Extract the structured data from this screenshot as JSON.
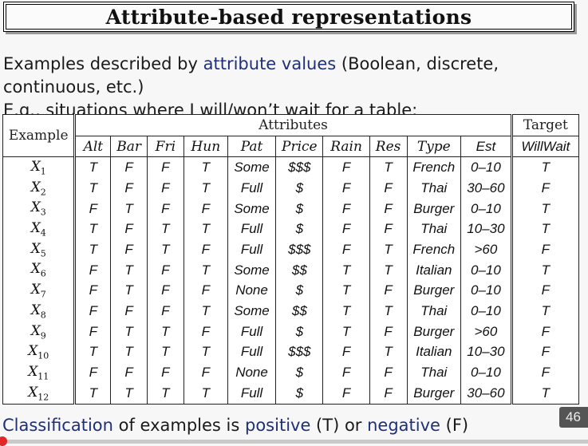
{
  "title": "Attribute-based representations",
  "intro": {
    "line1_a": "Examples described by ",
    "line1_link": "attribute values",
    "line1_b": " (Boolean, discrete, continuous, etc.)",
    "line2": "E.g., situations where I will/won’t wait for a table:"
  },
  "table": {
    "example_header": "Example",
    "attributes_header": "Attributes",
    "target_header": "Target",
    "attribute_names": [
      "Alt",
      "Bar",
      "Fri",
      "Hun",
      "Pat",
      "Price",
      "Rain",
      "Res",
      "Type",
      "Est"
    ],
    "target_name": "WillWait",
    "rows": [
      {
        "id": "X",
        "sub": "1",
        "values": [
          "T",
          "F",
          "F",
          "T",
          "Some",
          "$$$",
          "F",
          "T",
          "French",
          "0–10"
        ],
        "target": "T"
      },
      {
        "id": "X",
        "sub": "2",
        "values": [
          "T",
          "F",
          "F",
          "T",
          "Full",
          "$",
          "F",
          "F",
          "Thai",
          "30–60"
        ],
        "target": "F"
      },
      {
        "id": "X",
        "sub": "3",
        "values": [
          "F",
          "T",
          "F",
          "F",
          "Some",
          "$",
          "F",
          "F",
          "Burger",
          "0–10"
        ],
        "target": "T"
      },
      {
        "id": "X",
        "sub": "4",
        "values": [
          "T",
          "F",
          "T",
          "T",
          "Full",
          "$",
          "F",
          "F",
          "Thai",
          "10–30"
        ],
        "target": "T"
      },
      {
        "id": "X",
        "sub": "5",
        "values": [
          "T",
          "F",
          "T",
          "F",
          "Full",
          "$$$",
          "F",
          "T",
          "French",
          ">60"
        ],
        "target": "F"
      },
      {
        "id": "X",
        "sub": "6",
        "values": [
          "F",
          "T",
          "F",
          "T",
          "Some",
          "$$",
          "T",
          "T",
          "Italian",
          "0–10"
        ],
        "target": "T"
      },
      {
        "id": "X",
        "sub": "7",
        "values": [
          "F",
          "T",
          "F",
          "F",
          "None",
          "$",
          "T",
          "F",
          "Burger",
          "0–10"
        ],
        "target": "F"
      },
      {
        "id": "X",
        "sub": "8",
        "values": [
          "F",
          "F",
          "F",
          "T",
          "Some",
          "$$",
          "T",
          "T",
          "Thai",
          "0–10"
        ],
        "target": "T"
      },
      {
        "id": "X",
        "sub": "9",
        "values": [
          "F",
          "T",
          "T",
          "F",
          "Full",
          "$",
          "T",
          "F",
          "Burger",
          ">60"
        ],
        "target": "F"
      },
      {
        "id": "X",
        "sub": "10",
        "values": [
          "T",
          "T",
          "T",
          "T",
          "Full",
          "$$$",
          "F",
          "T",
          "Italian",
          "10–30"
        ],
        "target": "F"
      },
      {
        "id": "X",
        "sub": "11",
        "values": [
          "F",
          "F",
          "F",
          "F",
          "None",
          "$",
          "F",
          "F",
          "Thai",
          "0–10"
        ],
        "target": "F"
      },
      {
        "id": "X",
        "sub": "12",
        "values": [
          "T",
          "T",
          "T",
          "T",
          "Full",
          "$",
          "F",
          "F",
          "Burger",
          "30–60"
        ],
        "target": "T"
      }
    ]
  },
  "footer": {
    "a": "Classification",
    "b": " of examples is ",
    "c": "positive",
    "d": " (T) or ",
    "e": "negative",
    "f": " (F)"
  },
  "page_number": "46",
  "colors": {
    "accent_blue": "#1f2f7a",
    "progress_red": "#d3262a"
  },
  "progress": {
    "fraction": 0.0
  }
}
